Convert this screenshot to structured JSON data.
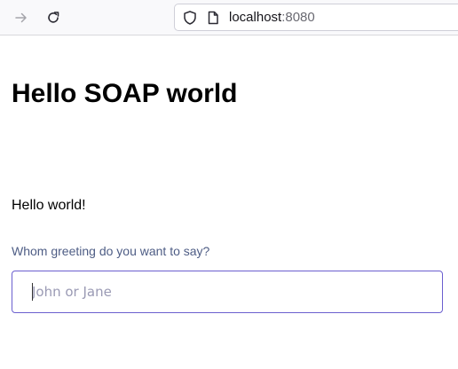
{
  "browser": {
    "url_host": "localhost",
    "url_port": ":8080",
    "icons": {
      "forward": "arrow-right-icon",
      "reload": "reload-icon",
      "shield": "shield-icon",
      "page": "page-icon"
    }
  },
  "page": {
    "title": "Hello SOAP world",
    "greeting": "Hello world!",
    "field_label": "Whom greeting do you want to say?",
    "input_value": "",
    "input_placeholder": "John or Jane"
  },
  "colors": {
    "label": "#4e5d85",
    "input_border": "#6b5fcf",
    "placeholder": "#9a9ab4"
  }
}
